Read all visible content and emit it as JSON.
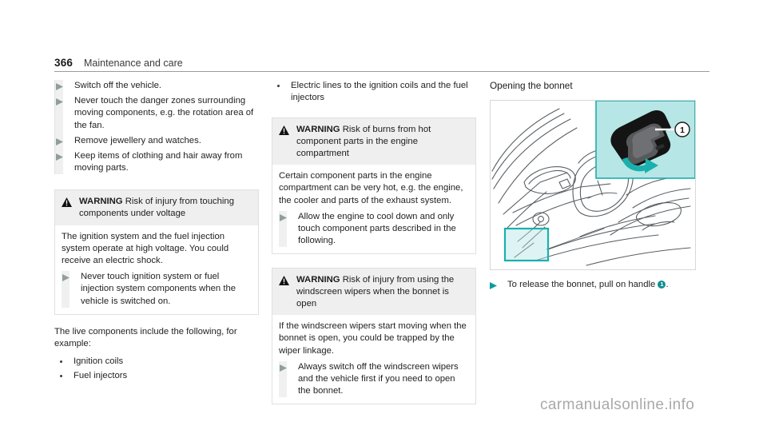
{
  "header": {
    "page_number": "366",
    "title": "Maintenance and care"
  },
  "column_left": {
    "steps_block": {
      "items": [
        "Switch off the vehicle.",
        "Never touch the danger zones surrounding moving components, e.g. the rotation area of the fan.",
        "Remove jewellery and watches.",
        "Keep items of clothing and hair away from moving parts."
      ]
    },
    "warning": {
      "label": "WARNING",
      "headline": "Risk of injury from touching components under voltage",
      "body": "The ignition system and the fuel injection system operate at high voltage. You could receive an electric shock.",
      "steps": [
        "Never touch ignition system or fuel injection system components when the vehicle is switched on."
      ]
    },
    "live_components_intro": "The live components include the following, for example:",
    "live_components": [
      "Ignition coils",
      "Fuel injectors"
    ]
  },
  "column_middle": {
    "bullets": [
      "Electric lines to the ignition coils and the fuel injectors"
    ],
    "warning_burns": {
      "label": "WARNING",
      "headline": "Risk of burns from hot component parts in the engine compartment",
      "body": "Certain component parts in the engine compartment can be very hot, e.g. the engine, the cooler and parts of the exhaust system.",
      "steps": [
        "Allow the engine to cool down and only touch component parts described in the following."
      ]
    },
    "warning_wipers": {
      "label": "WARNING",
      "headline": "Risk of injury from using the windscreen wipers when the bonnet is open",
      "body": "If the windscreen wipers start moving when the bonnet is open, you could be trapped by the wiper linkage.",
      "steps": [
        "Always switch off the windscreen wipers and the vehicle first if you need to open the bonnet."
      ]
    }
  },
  "column_right": {
    "section_heading": "Opening the bonnet",
    "figure": {
      "callout_number": "1",
      "inset_background_color": "#b6e6e6",
      "highlight_color": "#1ab0ad"
    },
    "caption_step_before": "To release the bonnet, pull on handle",
    "caption_step_badge": "1",
    "caption_step_after": "."
  },
  "watermark": "carmanualsonline.info",
  "colors": {
    "teal": "#0f9b9b",
    "teal_dark": "#0f8f92",
    "warning_header_bg": "#efefef",
    "step_bar": "#f0f0f0",
    "rule": "#9b9b9b"
  }
}
